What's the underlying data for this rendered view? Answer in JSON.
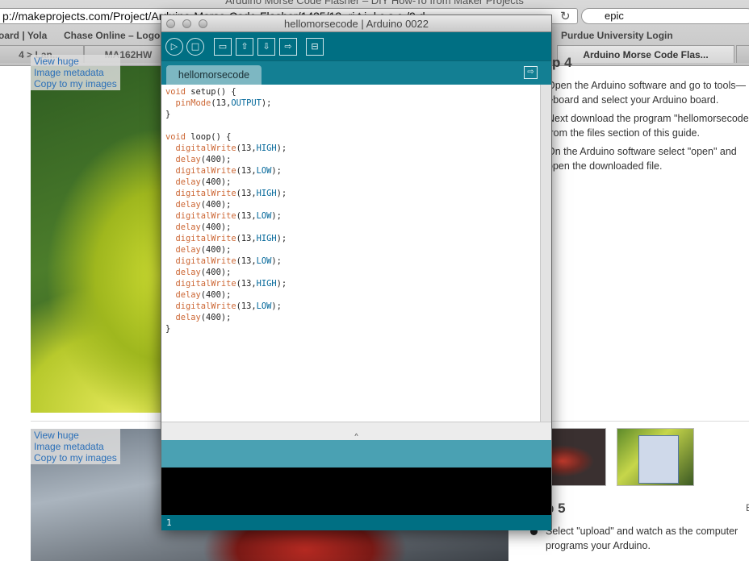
{
  "browser": {
    "window_title": "Arduino Morse Code Flasher – DIY How-To from Maker Projects",
    "url": "p://makeprojects.com/Project/Arduino-Morse-Code-Flasher/1435/13-.ri.t.i-.l.c.s.e./9.d.",
    "search_value": "epic",
    "bookmarks": [
      "oard | Yola",
      "Chase Online – Logon",
      "Purdue University Login"
    ],
    "tabs": [
      "4 > Lan...",
      "MA162HW",
      "Arduino Morse Code Flas..."
    ]
  },
  "page": {
    "image_links": [
      "View huge",
      "Image metadata",
      "Copy to my images"
    ],
    "step4_heading": "p 4",
    "step4_paras": [
      "Open the Arduino software and go to tools—>board and select your Arduino board.",
      "Next download the program \"hellomorsecode\" from the files section of this guide.",
      "On the Arduino software select \"open\" and open the downloaded file."
    ],
    "step5_heading": "p 5",
    "step5_text": "Select \"upload\" and watch as the computer programs your Arduino.",
    "edge_letter": "E"
  },
  "arduino": {
    "title": "hellomorsecode | Arduino 0022",
    "toolbar": {
      "verify_icon": "▷",
      "stop_icon": "□",
      "new_icon": "▭",
      "open_icon": "⇧",
      "save_icon": "⇩",
      "upload_icon": "⇨",
      "serial_icon": "⊟"
    },
    "tab_name": "hellomorsecode",
    "tab_menu_icon": "⇨",
    "splitter_glyph": "^",
    "line_number": "1"
  },
  "code": {
    "setup_lines": [
      "void setup() {",
      "  pinMode(13,OUTPUT);",
      "}"
    ],
    "loop_header": "void loop() {",
    "loop_body": [
      [
        "digitalWrite",
        "13",
        "HIGH"
      ],
      [
        "delay",
        "400"
      ],
      [
        "digitalWrite",
        "13",
        "LOW"
      ],
      [
        "delay",
        "400"
      ],
      [
        "digitalWrite",
        "13",
        "HIGH"
      ],
      [
        "delay",
        "400"
      ],
      [
        "digitalWrite",
        "13",
        "LOW"
      ],
      [
        "delay",
        "400"
      ],
      [
        "digitalWrite",
        "13",
        "HIGH"
      ],
      [
        "delay",
        "400"
      ],
      [
        "digitalWrite",
        "13",
        "LOW"
      ],
      [
        "delay",
        "400"
      ],
      [
        "digitalWrite",
        "13",
        "HIGH"
      ],
      [
        "delay",
        "400"
      ],
      [
        "digitalWrite",
        "13",
        "LOW"
      ],
      [
        "delay",
        "400"
      ]
    ],
    "closing": "}"
  },
  "colors": {
    "arduino_teal": "#006f83",
    "tab_teal": "#7db7c2",
    "keyword_orange": "#cc6633",
    "constant_blue": "#006699",
    "link_blue": "#2a6fb8"
  }
}
